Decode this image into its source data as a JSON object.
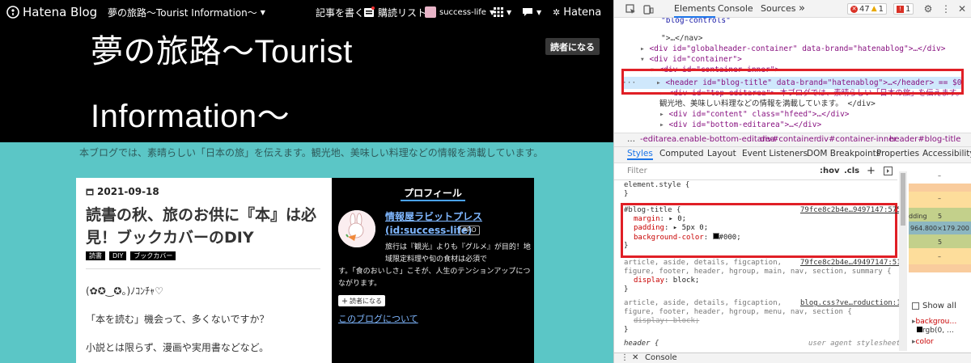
{
  "globalheader": {
    "logo_text": "Hatena Blog",
    "blog_menu": "夢の旅路〜Tourist Information〜",
    "write": "記事を書く",
    "subscribe_list": "購読リスト",
    "account": "success-life",
    "hatena": "Hatena"
  },
  "blog": {
    "title_line1": "夢の旅路〜Tourist",
    "title_line2": "Information〜",
    "subscribe_button": "読者になる",
    "description": "本ブログでは、素晴らしい「日本の旅」を伝えます。観光地、美味しい料理などの情報を満載しています。"
  },
  "entry": {
    "date": "2021-09-18",
    "title": "読書の秋、旅のお供に『本』は必見！ブックカバーのDIY",
    "tags": [
      "読書",
      "DIY",
      "ブックカバー"
    ],
    "paragraphs": [
      "(✿✪‿✪。)ﾉｺﾝﾁｬ♡",
      "「本を読む」機会って、多くないですか？",
      "小説とは限らず、漫画や実用書などなど。"
    ]
  },
  "profile": {
    "heading": "プロフィール",
    "name": "情報屋ラビットプレス",
    "id": "(id:success-life)",
    "pro": "PRO",
    "desc1": "旅行は『観光』よりも『グルメ』が目的！地域限定料理や旬の食材は必須で",
    "desc2": "す。「食のおいしさ」こそが、人生のテンションアップにつながります。",
    "read_button": "読者になる",
    "about_link": "このブログについて"
  },
  "devtools": {
    "tabs": [
      "Elements",
      "Console",
      "Sources"
    ],
    "more": "»",
    "errors": "47",
    "warnings": "1",
    "issues": "1",
    "dom_lines": [
      "\"blog-controls\"",
      "\">…</nav>",
      "<div id=\"globalheader-container\" data-brand=\"hatenablog\">…</div>",
      "<div id=\"container\">",
      "<div id=\"container-inner\">",
      "<header id=\"blog-title\" data-brand=\"hatenablog\">…</header> == $0",
      "<div id=\"top-editarea\"> 本ブログでは、素晴らしい「日本の旅」を伝えます。",
      "観光地、美味しい料理などの情報を満載しています。 </div>",
      "<div id=\"content\" class=\"hfeed\">…</div>",
      "<div id=\"bottom-editarea\">…</div>"
    ],
    "breadcrumb": [
      "…",
      "-editarea.enable-bottom-editarea",
      "div#container",
      "div#container-inner",
      "header#blog-title"
    ],
    "panel_tabs": [
      "Styles",
      "Computed",
      "Layout",
      "Event Listeners",
      "DOM Breakpoints",
      "Properties",
      "Accessibility"
    ],
    "filter_placeholder": "Filter",
    "hov": ":hov",
    "cls": ".cls",
    "style_lines": {
      "element_style": "element.style {",
      "close": "}",
      "rule1_selector": "#blog-title {",
      "rule1_source": "79fce8c2b4e…9497147:575",
      "margin_name": "margin",
      "margin_value": "▸ 0;",
      "padding_name": "padding",
      "padding_value": "▸ 5px 0;",
      "bg_name": "background-color",
      "bg_value": "#000;",
      "rule2_selector": "article, aside, details, figcaption,",
      "rule2_selector2": "figure, footer, header, hgroup, main, nav, section, summary {",
      "rule2_source": "79fce8c2b4e…49497147:51",
      "display_name": "display",
      "display_value": "block;",
      "rule3_selector": "article, aside, details, figcaption,",
      "rule3_selector2": "figure, footer, header, hgroup, menu, nav, section {",
      "rule3_source": "blog.css?ve…roduction:1",
      "ua_header": "header {",
      "ua_label": "user agent stylesheet"
    },
    "box": {
      "margin": "–",
      "padding_label": "dding",
      "padding": "5",
      "size": "964.800×179.200",
      "bottom5": "5",
      "dash": "–"
    },
    "show_all": "Show all",
    "computed1": "backgrou…",
    "computed1b": "rgb(0, …",
    "computed2": "color",
    "console": "Console"
  }
}
